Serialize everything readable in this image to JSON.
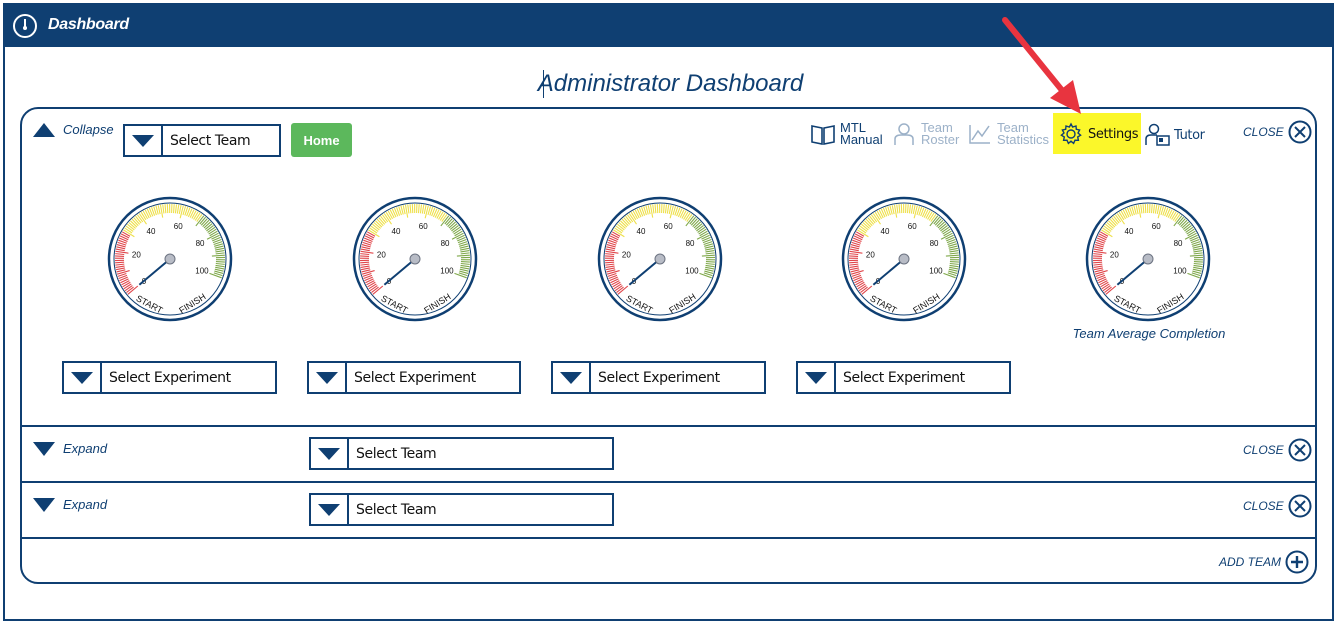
{
  "window": {
    "title": "Dashboard",
    "icon": "clock-icon"
  },
  "page": {
    "title": "Administrator Dashboard"
  },
  "colors": {
    "brand": "#0f3f72",
    "home": "#5cb85c",
    "highlight": "#fbf72a",
    "annotation_arrow": "#e8343f"
  },
  "team_panels": [
    {
      "toggle_label": "Collapse",
      "team_select": "Select Team",
      "home_label": "Home",
      "close_label": "CLOSE",
      "gauges": [
        {
          "scale_labels": [
            "0",
            "20",
            "40",
            "60",
            "80",
            "100"
          ],
          "start_label": "START",
          "finish_label": "FINISH",
          "value_percent": 0,
          "experiment_select": "Select Experiment"
        },
        {
          "scale_labels": [
            "0",
            "20",
            "40",
            "60",
            "80",
            "100"
          ],
          "start_label": "START",
          "finish_label": "FINISH",
          "value_percent": 0,
          "experiment_select": "Select Experiment"
        },
        {
          "scale_labels": [
            "0",
            "20",
            "40",
            "60",
            "80",
            "100"
          ],
          "start_label": "START",
          "finish_label": "FINISH",
          "value_percent": 0,
          "experiment_select": "Select Experiment"
        },
        {
          "scale_labels": [
            "0",
            "20",
            "40",
            "60",
            "80",
            "100"
          ],
          "start_label": "START",
          "finish_label": "FINISH",
          "value_percent": 0,
          "experiment_select": "Select Experiment"
        },
        {
          "scale_labels": [
            "0",
            "20",
            "40",
            "60",
            "80",
            "100"
          ],
          "start_label": "START",
          "finish_label": "FINISH",
          "value_percent": 0,
          "caption": "Team Average Completion"
        }
      ]
    },
    {
      "toggle_label": "Expand",
      "team_select": "Select Team",
      "close_label": "CLOSE"
    },
    {
      "toggle_label": "Expand",
      "team_select": "Select Team",
      "close_label": "CLOSE"
    }
  ],
  "toolbar": {
    "mtl_manual": {
      "line1": "MTL",
      "line2": "Manual",
      "icon": "book-icon"
    },
    "team_roster": {
      "line1": "Team",
      "line2": "Roster",
      "icon": "person-icon",
      "disabled": true
    },
    "team_statistics": {
      "line1": "Team",
      "line2": "Statistics",
      "icon": "line-chart-icon",
      "disabled": true
    },
    "settings": {
      "label": "Settings",
      "icon": "gear-icon",
      "highlighted": true
    },
    "tutor": {
      "label": "Tutor",
      "icon": "tutor-icon"
    }
  },
  "add_team": {
    "label": "ADD TEAM",
    "icon": "plus-circle-icon"
  }
}
